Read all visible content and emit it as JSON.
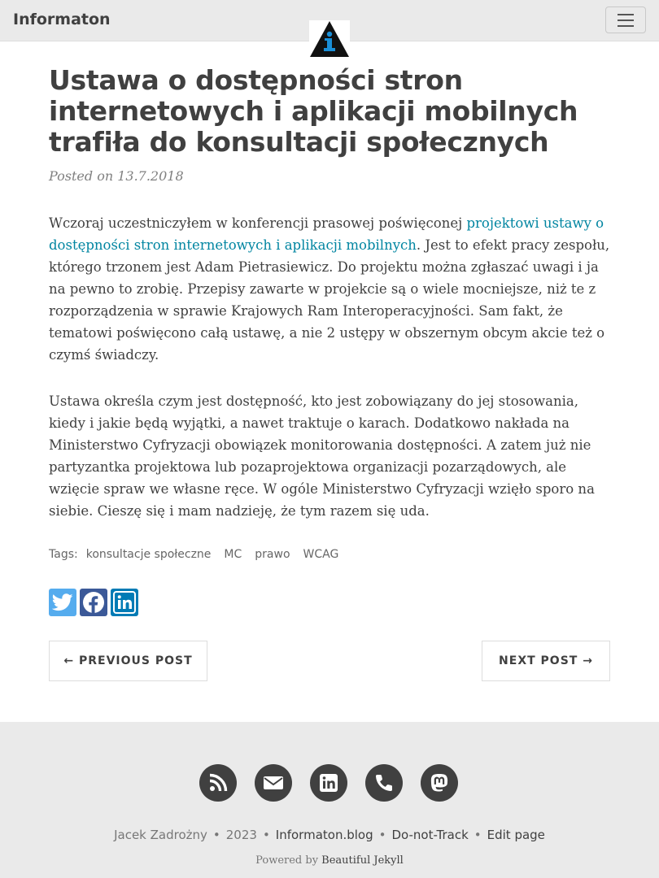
{
  "navbar": {
    "brand": "Informaton",
    "logo_icon": "info-triangle-logo-icon",
    "menu_icon": "hamburger-menu-icon"
  },
  "post": {
    "title": "Ustawa o dostępności stron internetowych i aplikacji mobilnych trafiła do konsultacji społecznych",
    "posted": "Posted on 13.7.2018",
    "p1_before": "Wczoraj uczestniczyłem w konferencji prasowej poświęconej ",
    "p1_link": "projektowi ustawy o dostępności stron internetowych i aplikacji mobilnych",
    "p1_after": ". Jest to efekt pracy zespołu, którego trzonem jest Adam Pietrasiewicz. Do projektu można zgłaszać uwagi i ja na pewno to zrobię. Przepisy zawarte w projekcie są o wiele mocniejsze, niż te z rozporządzenia w sprawie Krajowych Ram Interoperacyjności. Sam fakt, że tematowi poświęcono całą ustawę, a nie 2 ustępy w obszernym obcym akcie też o czymś świadczy.",
    "p2": "Ustawa określa czym jest dostępność, kto jest zobowiązany do jej stosowania, kiedy i jakie będą wyjątki, a nawet traktuje o karach. Dodatkowo nakłada na Ministerstwo Cyfryzacji obowiązek monitorowania dostępności. A zatem już nie partyzantka projektowa lub pozaprojektowa organizacji pozarządowych, ale wzięcie spraw we własne ręce. W ogóle Ministerstwo Cyfryzacji wzięło sporo na siebie. Cieszę się i mam nadzieję, że tym razem się uda."
  },
  "tags": {
    "label": "Tags:",
    "items": [
      "konsultacje społeczne",
      "MC",
      "prawo",
      "WCAG"
    ]
  },
  "share": {
    "icons": [
      "twitter-icon",
      "facebook-icon",
      "linkedin-icon"
    ],
    "colors": {
      "twitter": "#55acee",
      "facebook": "#3b5998",
      "linkedin": "#007bb5"
    }
  },
  "pager": {
    "previous": "← PREVIOUS POST",
    "next": "NEXT POST →"
  },
  "footer": {
    "icons": [
      "rss-icon",
      "email-icon",
      "linkedin-icon",
      "phone-icon",
      "mastodon-icon"
    ],
    "author": "Jacek Zadrożny",
    "sep": "•",
    "year": "2023",
    "site": "Informaton.blog",
    "dnt": "Do-not-Track",
    "edit": "Edit page",
    "powered_prefix": "Powered by ",
    "powered_link": "Beautiful Jekyll"
  },
  "colors": {
    "link": "#0085a1",
    "nav_bg": "#eaeaea",
    "text": "#404040",
    "logo_blue": "#1a8fd8"
  }
}
